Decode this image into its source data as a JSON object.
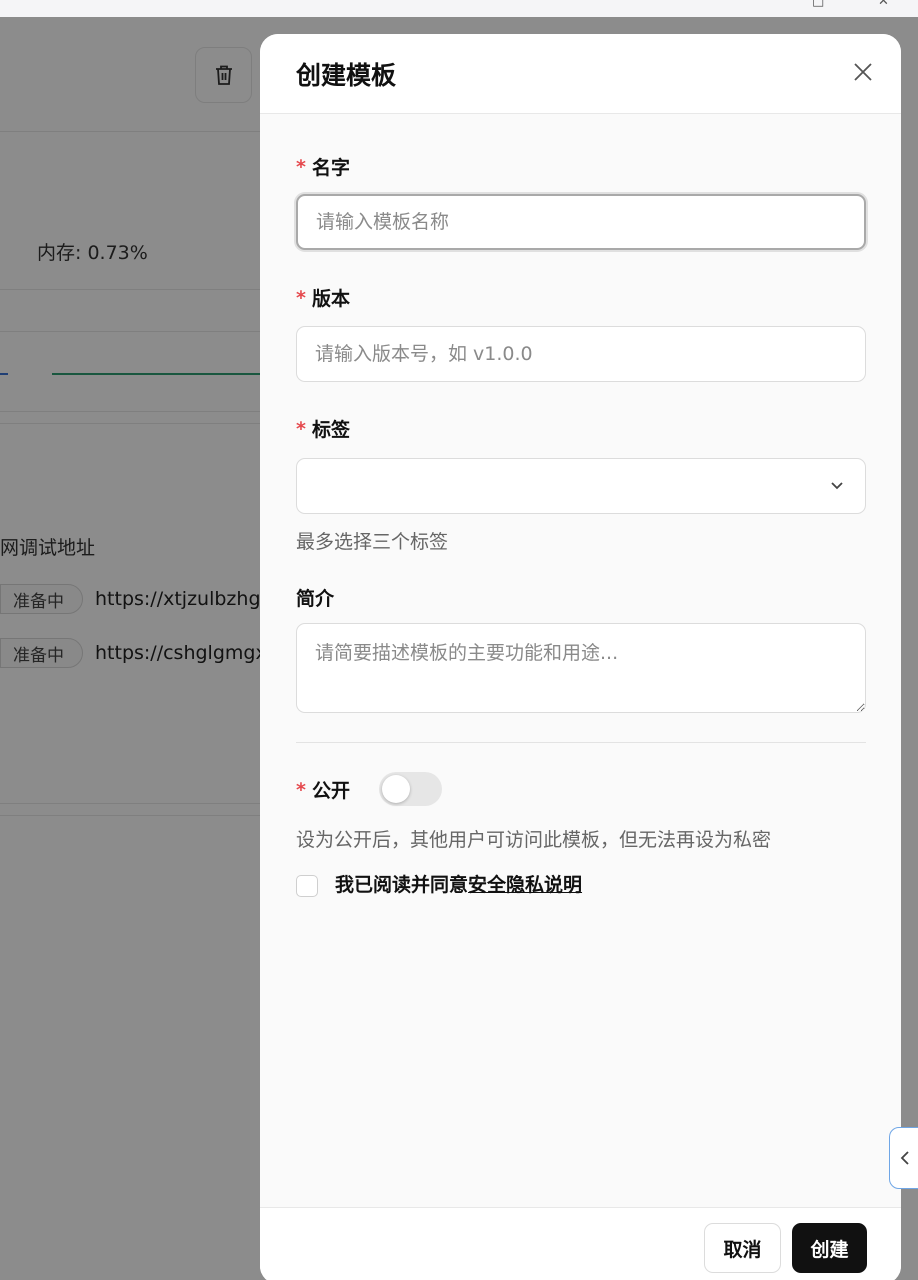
{
  "background": {
    "memory_text": "内存: 0.73%",
    "debug_label": "网调试地址",
    "rows": [
      {
        "status": "准备中",
        "url": "https://xtjzulbzhg"
      },
      {
        "status": "准备中",
        "url": "https://cshglgmgx"
      }
    ]
  },
  "dialog": {
    "title": "创建模板",
    "required_mark": "*",
    "name": {
      "label": "名字",
      "placeholder": "请输入模板名称",
      "value": ""
    },
    "version": {
      "label": "版本",
      "placeholder": "请输入版本号，如 v1.0.0",
      "value": ""
    },
    "tags": {
      "label": "标签",
      "selected": "",
      "help": "最多选择三个标签"
    },
    "description": {
      "label": "简介",
      "placeholder": "请简要描述模板的主要功能和用途..."
    },
    "public": {
      "label": "公开",
      "enabled": false,
      "help": "设为公开后，其他用户可访问此模板，但无法再设为私密"
    },
    "agreement": {
      "checked": false,
      "text": "我已阅读并同意",
      "link": "安全隐私说明"
    },
    "buttons": {
      "cancel": "取消",
      "create": "创建"
    }
  },
  "icons": {
    "close": "close-icon",
    "trash": "trash-icon",
    "chevron": "chevron-down-icon",
    "side_tab": "chevron-left-icon"
  }
}
